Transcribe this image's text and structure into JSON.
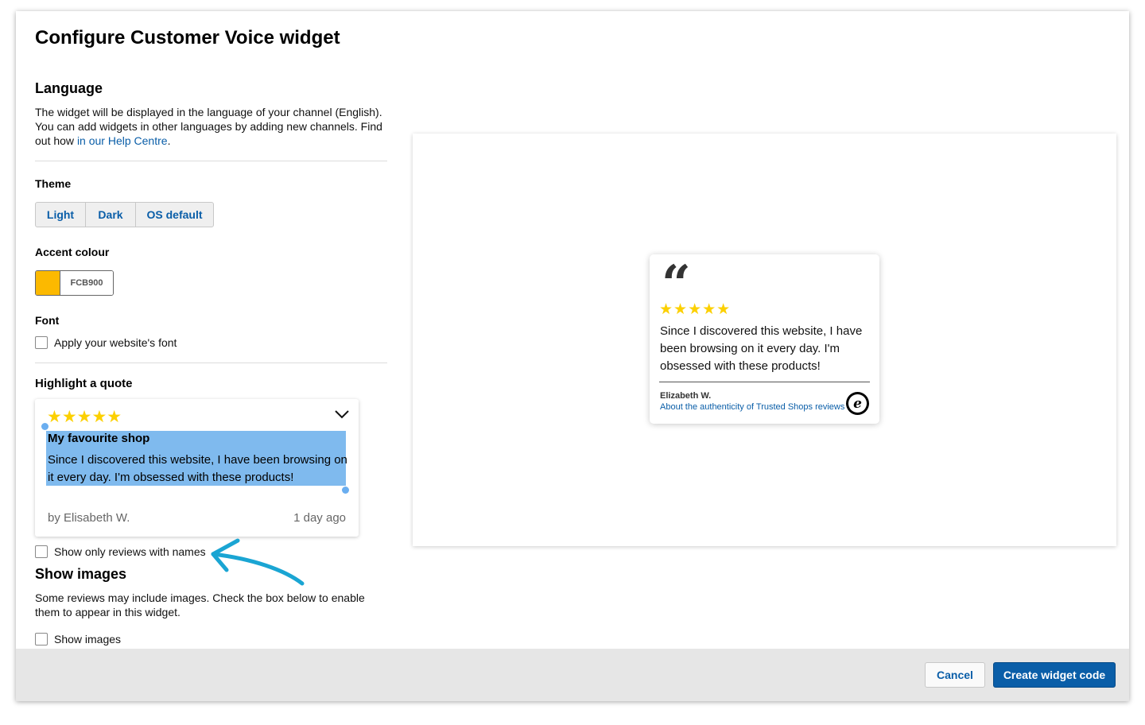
{
  "dialog": {
    "title": "Configure Customer Voice widget"
  },
  "language": {
    "heading": "Language",
    "text_before_link": "The widget will be displayed in the language of your channel (English). You can add widgets in other languages by adding new channels. Find out how ",
    "link_text": "in our Help Centre",
    "text_after_link": "."
  },
  "theme": {
    "heading": "Theme",
    "options": [
      "Light",
      "Dark",
      "OS default"
    ]
  },
  "accent": {
    "heading": "Accent colour",
    "hex": "FCB900",
    "color": "#FCB900"
  },
  "font": {
    "heading": "Font",
    "checkbox_label": "Apply your website's font",
    "checked": false
  },
  "highlight": {
    "heading": "Highlight a quote",
    "stars": "★★★★★",
    "rating": 5,
    "quote_title": "My favourite shop",
    "quote_text": "Since I discovered this website, I have been browsing on it every day. I'm obsessed with these products!",
    "author": "by Elisabeth W.",
    "time": "1 day ago",
    "names_only_label": "Show only reviews with names",
    "names_only_checked": false
  },
  "images": {
    "heading": "Show images",
    "text": "Some reviews may include images. Check the box below to enable them to appear in this widget.",
    "checkbox_label": "Show images",
    "checked": false
  },
  "preview": {
    "quote_icon": "quote-mark-icon",
    "stars": "★★★★★",
    "text": "Since I discovered this website, I have been browsing on it every day. I'm obsessed with these products!",
    "name": "Elizabeth W.",
    "link": "About the authenticity of Trusted Shops reviews",
    "badge": "e"
  },
  "footer": {
    "cancel": "Cancel",
    "create": "Create widget code"
  },
  "colors": {
    "accent_blue": "#0a5ea8",
    "star_yellow": "#fcd000",
    "selection": "#7fbaee",
    "arrow": "#1aa5d3"
  }
}
